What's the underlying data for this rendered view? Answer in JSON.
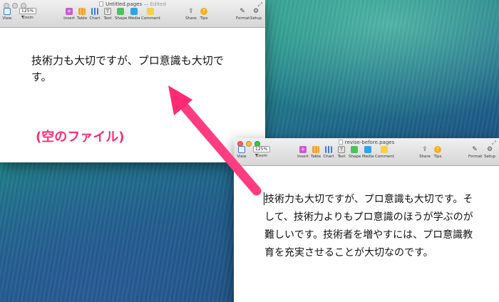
{
  "window_a": {
    "title": "Untitled.pages",
    "title_suffix": "— Edited",
    "zoom": "125%",
    "labels": {
      "view": "View",
      "zoom": "Zoom",
      "insert": "Insert",
      "table": "Table",
      "chart": "Chart",
      "text": "Text",
      "shape": "Shape",
      "media": "Media",
      "comment": "Comment",
      "share": "Share",
      "tips": "Tips",
      "format": "Format",
      "setup": "Setup"
    },
    "body": "技術力も大切ですが、プロ意識も大切です。"
  },
  "window_b": {
    "title": "revise-before.pages",
    "zoom": "125%",
    "labels": {
      "view": "View",
      "zoom": "Zoom",
      "insert": "Insert",
      "table": "Table",
      "chart": "Chart",
      "text": "Text",
      "shape": "Shape",
      "media": "Media",
      "comment": "Comment",
      "share": "Share",
      "tips": "Tips",
      "format": "Format",
      "setup": "Setup"
    },
    "body": "技術力も大切ですが、プロ意識も大切です。そして、技術力よりもプロ意識のほうが学ぶのが難しいです。技術者を増やすには、プロ意識教育を充実させることが大切なのです。"
  },
  "annotation": {
    "label": "(空のファイル)",
    "color": "#ff2a73"
  }
}
